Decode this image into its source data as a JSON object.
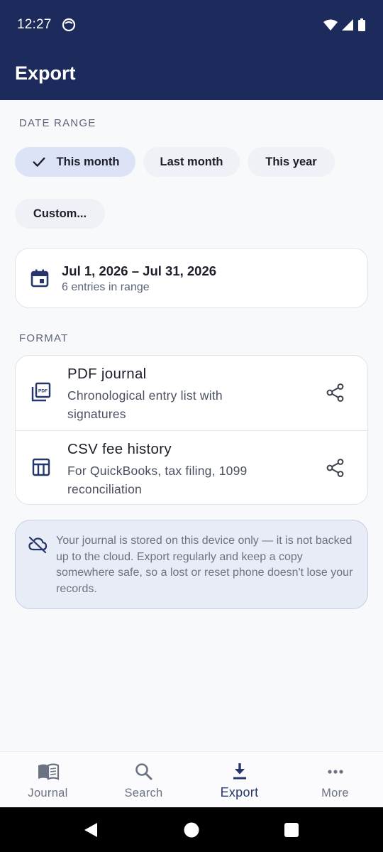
{
  "status_bar": {
    "time": "12:27"
  },
  "app_bar": {
    "title": "Export"
  },
  "date_range": {
    "section_label": "DATE RANGE",
    "chips": [
      {
        "label": "This month",
        "selected": true
      },
      {
        "label": "Last month",
        "selected": false
      },
      {
        "label": "This year",
        "selected": false
      },
      {
        "label": "Custom...",
        "selected": false
      }
    ],
    "summary": {
      "range": "Jul 1, 2026 – Jul 31, 2026",
      "count": "6 entries in range",
      "icon": "calendar-icon"
    }
  },
  "format": {
    "section_label": "FORMAT",
    "options": [
      {
        "title": "PDF journal",
        "description": "Chronological entry list with signatures",
        "icon": "pdf-icon",
        "action_icon": "share-icon"
      },
      {
        "title": "CSV fee history",
        "description": "For QuickBooks, tax filing, 1099 reconciliation",
        "icon": "table-icon",
        "action_icon": "share-icon"
      }
    ]
  },
  "notice": {
    "icon": "cloud-off-icon",
    "text": "Your journal is stored on this device only — it is not backed up to the cloud. Export regularly and keep a copy somewhere safe, so a lost or reset phone doesn't lose your records."
  },
  "bottom_nav": {
    "items": [
      {
        "label": "Journal",
        "icon": "book-icon",
        "active": false
      },
      {
        "label": "Search",
        "icon": "search-icon",
        "active": false
      },
      {
        "label": "Export",
        "icon": "download-icon",
        "active": true
      },
      {
        "label": "More",
        "icon": "more-icon",
        "active": false
      }
    ]
  },
  "colors": {
    "app_bar": "#1c2b5c",
    "accent": "#25366a",
    "chip_selected": "#dde3f7",
    "notice_bg": "#e8ecf6"
  }
}
